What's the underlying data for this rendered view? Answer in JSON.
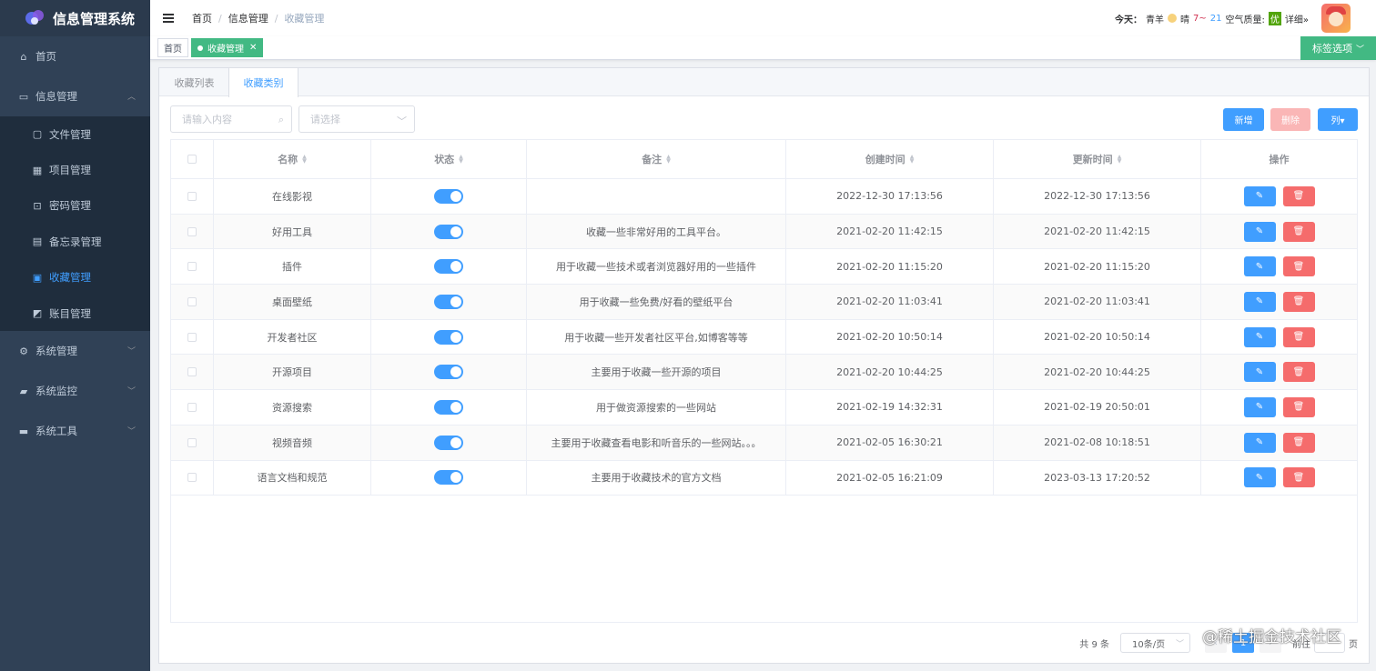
{
  "app": {
    "title": "信息管理系统"
  },
  "sidebar": {
    "home": "首页",
    "info_mgmt": "信息管理",
    "sub_items": [
      {
        "label": "文件管理",
        "icon": "folder-icon"
      },
      {
        "label": "项目管理",
        "icon": "grid-icon"
      },
      {
        "label": "密码管理",
        "icon": "lock-icon"
      },
      {
        "label": "备忘录管理",
        "icon": "memo-icon"
      },
      {
        "label": "收藏管理",
        "icon": "bookmark-icon",
        "active": true
      },
      {
        "label": "账目管理",
        "icon": "chart-icon"
      }
    ],
    "sys_mgmt": "系统管理",
    "sys_monitor": "系统监控",
    "sys_tools": "系统工具"
  },
  "header": {
    "breadcrumb": [
      "首页",
      "信息管理",
      "收藏管理"
    ],
    "today_label": "今天：",
    "city": "青羊",
    "weather": "晴",
    "temp": "7~",
    "aq_num": "21",
    "aq_label": "空气质量:",
    "aq_level": "优",
    "detail": "详细»"
  },
  "tags": {
    "home": "首页",
    "current": "收藏管理",
    "options": "标签选项"
  },
  "tabs": [
    "收藏列表",
    "收藏类别"
  ],
  "toolbar": {
    "search_placeholder": "请输入内容",
    "select_placeholder": "请选择",
    "add": "新增",
    "delete": "删除",
    "columns": "列▾"
  },
  "table": {
    "headers": [
      "名称",
      "状态",
      "备注",
      "创建时间",
      "更新时间",
      "操作"
    ],
    "rows": [
      {
        "name": "在线影视",
        "note": "",
        "created": "2022-12-30 17:13:56",
        "updated": "2022-12-30 17:13:56"
      },
      {
        "name": "好用工具",
        "note": "收藏一些非常好用的工具平台。",
        "created": "2021-02-20 11:42:15",
        "updated": "2021-02-20 11:42:15"
      },
      {
        "name": "插件",
        "note": "用于收藏一些技术或者浏览器好用的一些插件",
        "created": "2021-02-20 11:15:20",
        "updated": "2021-02-20 11:15:20"
      },
      {
        "name": "桌面壁纸",
        "note": "用于收藏一些免费/好看的壁纸平台",
        "created": "2021-02-20 11:03:41",
        "updated": "2021-02-20 11:03:41"
      },
      {
        "name": "开发者社区",
        "note": "用于收藏一些开发者社区平台,如博客等等",
        "created": "2021-02-20 10:50:14",
        "updated": "2021-02-20 10:50:14"
      },
      {
        "name": "开源项目",
        "note": "主要用于收藏一些开源的项目",
        "created": "2021-02-20 10:44:25",
        "updated": "2021-02-20 10:44:25"
      },
      {
        "name": "资源搜索",
        "note": "用于做资源搜索的一些网站",
        "created": "2021-02-19 14:32:31",
        "updated": "2021-02-19 20:50:01"
      },
      {
        "name": "视频音频",
        "note": "主要用于收藏查看电影和听音乐的一些网站。。。",
        "created": "2021-02-05 16:30:21",
        "updated": "2021-02-08 10:18:51"
      },
      {
        "name": "语言文档和规范",
        "note": "主要用于收藏技术的官方文档",
        "created": "2021-02-05 16:21:09",
        "updated": "2023-03-13 17:20:52"
      }
    ]
  },
  "pagination": {
    "total": "共 9 条",
    "size": "10条/页",
    "current_page": "1",
    "goto": "前往",
    "page_suffix": "页"
  },
  "watermark": "@稀土掘金技术社区",
  "colors": {
    "sidebar": "#304156",
    "primary": "#409eff",
    "success": "#42b983",
    "danger": "#f56c6c"
  }
}
